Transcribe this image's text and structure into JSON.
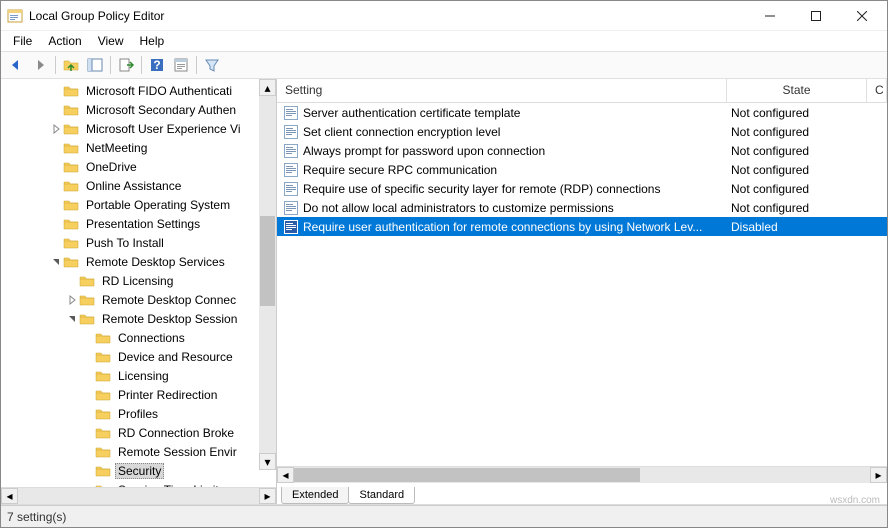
{
  "window": {
    "title": "Local Group Policy Editor"
  },
  "menu": {
    "items": [
      "File",
      "Action",
      "View",
      "Help"
    ]
  },
  "toolbar": {
    "icons": [
      "back",
      "forward",
      "up",
      "show-hide",
      "export",
      "help",
      "properties",
      "filter"
    ]
  },
  "tree": {
    "items": [
      {
        "indent": 3,
        "expand": "",
        "label": "Microsoft FIDO Authenticati"
      },
      {
        "indent": 3,
        "expand": "",
        "label": "Microsoft Secondary Authen"
      },
      {
        "indent": 3,
        "expand": "closed",
        "label": "Microsoft User Experience Vi"
      },
      {
        "indent": 3,
        "expand": "",
        "label": "NetMeeting"
      },
      {
        "indent": 3,
        "expand": "",
        "label": "OneDrive"
      },
      {
        "indent": 3,
        "expand": "",
        "label": "Online Assistance"
      },
      {
        "indent": 3,
        "expand": "",
        "label": "Portable Operating System"
      },
      {
        "indent": 3,
        "expand": "",
        "label": "Presentation Settings"
      },
      {
        "indent": 3,
        "expand": "",
        "label": "Push To Install"
      },
      {
        "indent": 3,
        "expand": "open",
        "label": "Remote Desktop Services"
      },
      {
        "indent": 4,
        "expand": "",
        "label": "RD Licensing"
      },
      {
        "indent": 4,
        "expand": "closed",
        "label": "Remote Desktop Connec"
      },
      {
        "indent": 4,
        "expand": "open",
        "label": "Remote Desktop Session"
      },
      {
        "indent": 5,
        "expand": "",
        "label": "Connections"
      },
      {
        "indent": 5,
        "expand": "",
        "label": "Device and Resource"
      },
      {
        "indent": 5,
        "expand": "",
        "label": "Licensing"
      },
      {
        "indent": 5,
        "expand": "",
        "label": "Printer Redirection"
      },
      {
        "indent": 5,
        "expand": "",
        "label": "Profiles"
      },
      {
        "indent": 5,
        "expand": "",
        "label": "RD Connection Broke"
      },
      {
        "indent": 5,
        "expand": "",
        "label": "Remote Session Envir"
      },
      {
        "indent": 5,
        "expand": "",
        "label": "Security",
        "selected": true
      },
      {
        "indent": 5,
        "expand": "",
        "label": "Session Time Limits"
      }
    ]
  },
  "list": {
    "header": {
      "setting": "Setting",
      "state": "State",
      "c": "C"
    },
    "rows": [
      {
        "setting": "Server authentication certificate template",
        "state": "Not configured"
      },
      {
        "setting": "Set client connection encryption level",
        "state": "Not configured"
      },
      {
        "setting": "Always prompt for password upon connection",
        "state": "Not configured"
      },
      {
        "setting": "Require secure RPC communication",
        "state": "Not configured"
      },
      {
        "setting": "Require use of specific security layer for remote (RDP) connections",
        "state": "Not configured"
      },
      {
        "setting": "Do not allow local administrators to customize permissions",
        "state": "Not configured"
      },
      {
        "setting": "Require user authentication for remote connections by using Network Lev...",
        "state": "Disabled",
        "selected": true
      }
    ]
  },
  "tabs": {
    "extended": "Extended",
    "standard": "Standard"
  },
  "status": {
    "text": "7 setting(s)"
  },
  "watermark": "wsxdn.com"
}
